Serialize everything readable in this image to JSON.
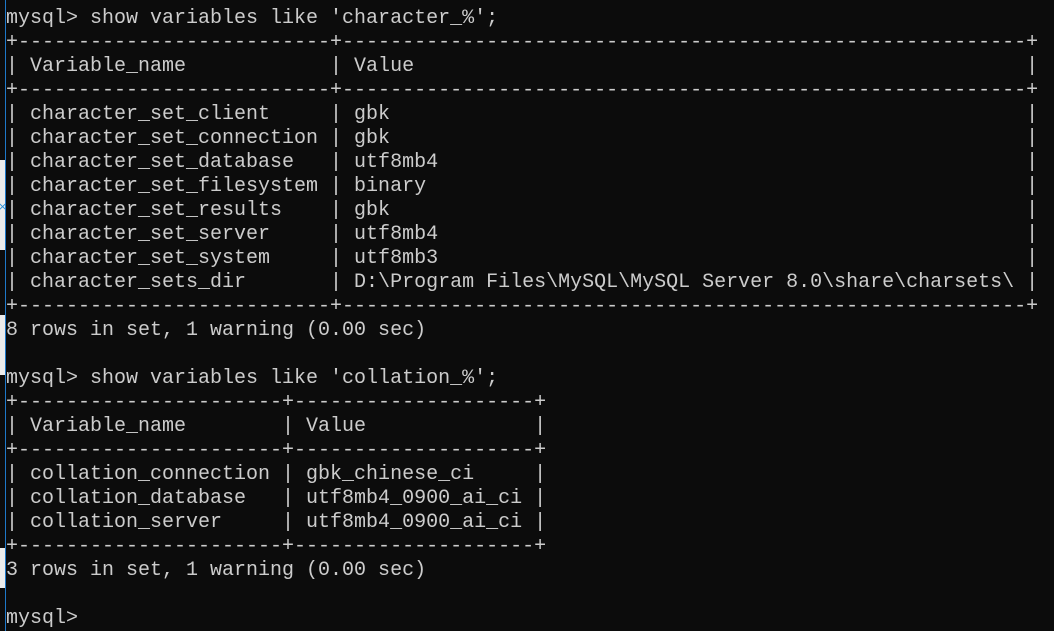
{
  "window": {
    "colors": {
      "background": "#0c0c0c",
      "text": "#cccccc",
      "accent": "#1e78c8"
    }
  },
  "prompt": "mysql>",
  "blocks": [
    {
      "command": "show variables like 'character_%';",
      "headers": [
        "Variable_name",
        "Value"
      ],
      "rows": [
        [
          "character_set_client",
          "gbk"
        ],
        [
          "character_set_connection",
          "gbk"
        ],
        [
          "character_set_database",
          "utf8mb4"
        ],
        [
          "character_set_filesystem",
          "binary"
        ],
        [
          "character_set_results",
          "gbk"
        ],
        [
          "character_set_server",
          "utf8mb4"
        ],
        [
          "character_set_system",
          "utf8mb3"
        ],
        [
          "character_sets_dir",
          "D:\\Program Files\\MySQL\\MySQL Server 8.0\\share\\charsets\\"
        ]
      ],
      "summary": "8 rows in set, 1 warning (0.00 sec)"
    },
    {
      "command": "show variables like 'collation_%';",
      "headers": [
        "Variable_name",
        "Value"
      ],
      "rows": [
        [
          "collation_connection",
          "gbk_chinese_ci"
        ],
        [
          "collation_database",
          "utf8mb4_0900_ai_ci"
        ],
        [
          "collation_server",
          "utf8mb4_0900_ai_ci"
        ]
      ],
      "summary": "3 rows in set, 1 warning (0.00 sec)"
    }
  ],
  "final_prompt": "mysql>",
  "side_strip": {
    "mark_icon": "close-icon",
    "mark_glyph": "×"
  }
}
